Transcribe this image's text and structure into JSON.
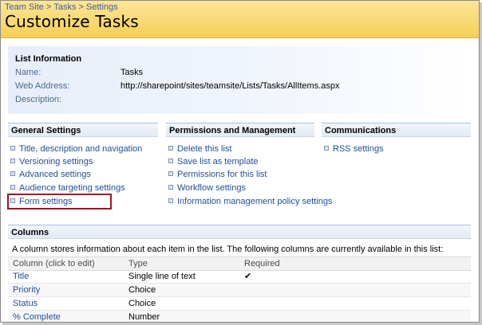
{
  "breadcrumb": {
    "items": [
      "Team Site",
      "Tasks",
      "Settings"
    ],
    "separator": ">"
  },
  "page_title": "Customize Tasks",
  "list_information": {
    "heading": "List Information",
    "name_label": "Name:",
    "name_value": "Tasks",
    "web_address_label": "Web Address:",
    "web_address_value": "http://sharepoint/sites/teamsite/Lists/Tasks/AllItems.aspx",
    "description_label": "Description:",
    "description_value": ""
  },
  "general_settings": {
    "heading": "General Settings",
    "items": [
      "Title, description and navigation",
      "Versioning settings",
      "Advanced settings",
      "Audience targeting settings",
      "Form settings"
    ]
  },
  "permissions": {
    "heading": "Permissions and Management",
    "items": [
      "Delete this list",
      "Save list as template",
      "Permissions for this list",
      "Workflow settings",
      "Information management policy settings"
    ]
  },
  "communications": {
    "heading": "Communications",
    "items": [
      "RSS settings"
    ]
  },
  "columns": {
    "heading": "Columns",
    "description": "A column stores information about each item in the list. The following columns are currently available in this list:",
    "headers": {
      "column": "Column (click to edit)",
      "type": "Type",
      "required": "Required"
    },
    "rows": [
      {
        "name": "Title",
        "type": "Single line of text",
        "required_mark": "✔"
      },
      {
        "name": "Priority",
        "type": "Choice",
        "required_mark": ""
      },
      {
        "name": "Status",
        "type": "Choice",
        "required_mark": ""
      },
      {
        "name": "% Complete",
        "type": "Number",
        "required_mark": ""
      }
    ]
  },
  "colors": {
    "link": "#1f4e9a",
    "header_bg": "#f6cf55",
    "highlight_border": "#a3121f"
  }
}
